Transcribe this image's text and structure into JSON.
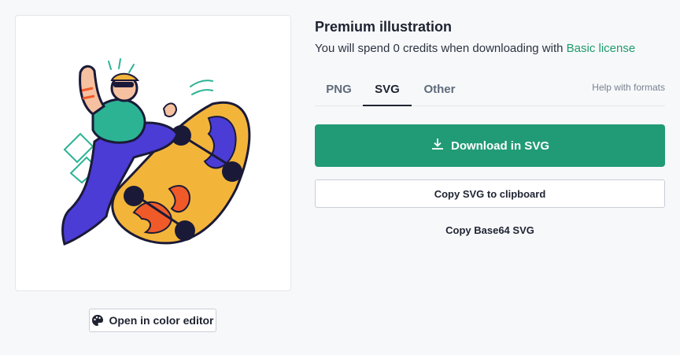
{
  "preview": {
    "image_alt": "Skateboarder illustration",
    "color_editor_label": "Open in color editor"
  },
  "header": {
    "title": "Premium illustration",
    "subtitle_prefix": "You will spend 0 credits when downloading with ",
    "license_link": "Basic license"
  },
  "tabs": [
    {
      "label": "PNG",
      "active": false
    },
    {
      "label": "SVG",
      "active": true
    },
    {
      "label": "Other",
      "active": false
    }
  ],
  "help_label": "Help with formats",
  "actions": {
    "download_label": "Download in SVG",
    "copy_label": "Copy SVG to clipboard",
    "copy_base64_label": "Copy Base64 SVG"
  },
  "colors": {
    "accent": "#219b75",
    "link": "#1f9b6c"
  }
}
